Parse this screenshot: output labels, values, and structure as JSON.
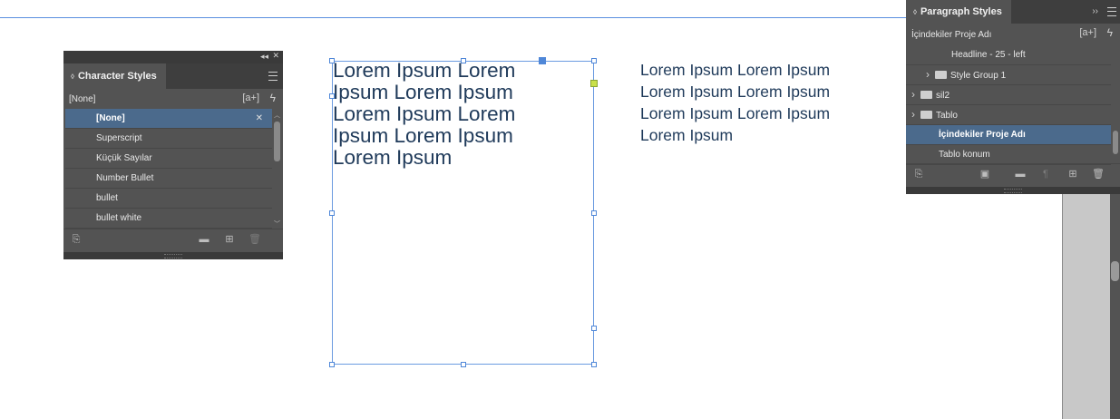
{
  "character_styles": {
    "title": "Character Styles",
    "current_style": "[None]",
    "new_style_icon": "[a+]",
    "items": [
      {
        "label": "[None]",
        "selected": true
      },
      {
        "label": "Superscript",
        "selected": false
      },
      {
        "label": "Küçük Sayılar",
        "selected": false
      },
      {
        "label": "Number Bullet",
        "selected": false
      },
      {
        "label": "bullet",
        "selected": false
      },
      {
        "label": "bullet white",
        "selected": false
      }
    ]
  },
  "paragraph_styles": {
    "title": "Paragraph Styles",
    "current_style": "İçindekiler Proje Adı",
    "new_style_icon": "[a+]",
    "items": [
      {
        "label": "Headline - 25 - left",
        "indent": 2,
        "folder": false,
        "chevron": false,
        "selected": false
      },
      {
        "label": "Style Group 1",
        "indent": 1,
        "folder": true,
        "chevron": true,
        "selected": false
      },
      {
        "label": "sil2",
        "indent": 0,
        "folder": true,
        "chevron": true,
        "selected": false
      },
      {
        "label": "Tablo",
        "indent": 0,
        "folder": true,
        "chevron": true,
        "selected": false
      },
      {
        "label": "İçindekiler Proje Adı",
        "indent": 1,
        "folder": false,
        "chevron": false,
        "selected": true
      },
      {
        "label": "Tablo konum",
        "indent": 1,
        "folder": false,
        "chevron": false,
        "selected": false
      }
    ]
  },
  "canvas": {
    "frame_text": [
      "Lorem Ipsum Lorem",
      "Ipsum Lorem Ipsum",
      "Lorem Ipsum Lorem",
      "Ipsum Lorem Ipsum",
      "Lorem Ipsum"
    ],
    "plain_text": [
      "Lorem Ipsum Lorem Ipsum",
      "Lorem Ipsum Lorem Ipsum",
      "Lorem Ipsum Lorem Ipsum",
      "Lorem Ipsum"
    ]
  },
  "colors": {
    "panel_bg": "#535353",
    "selected_row": "#4b6a8c",
    "text_color": "#1f3a5a",
    "frame_border": "#6b9be0",
    "guide": "#5b8fe0"
  }
}
